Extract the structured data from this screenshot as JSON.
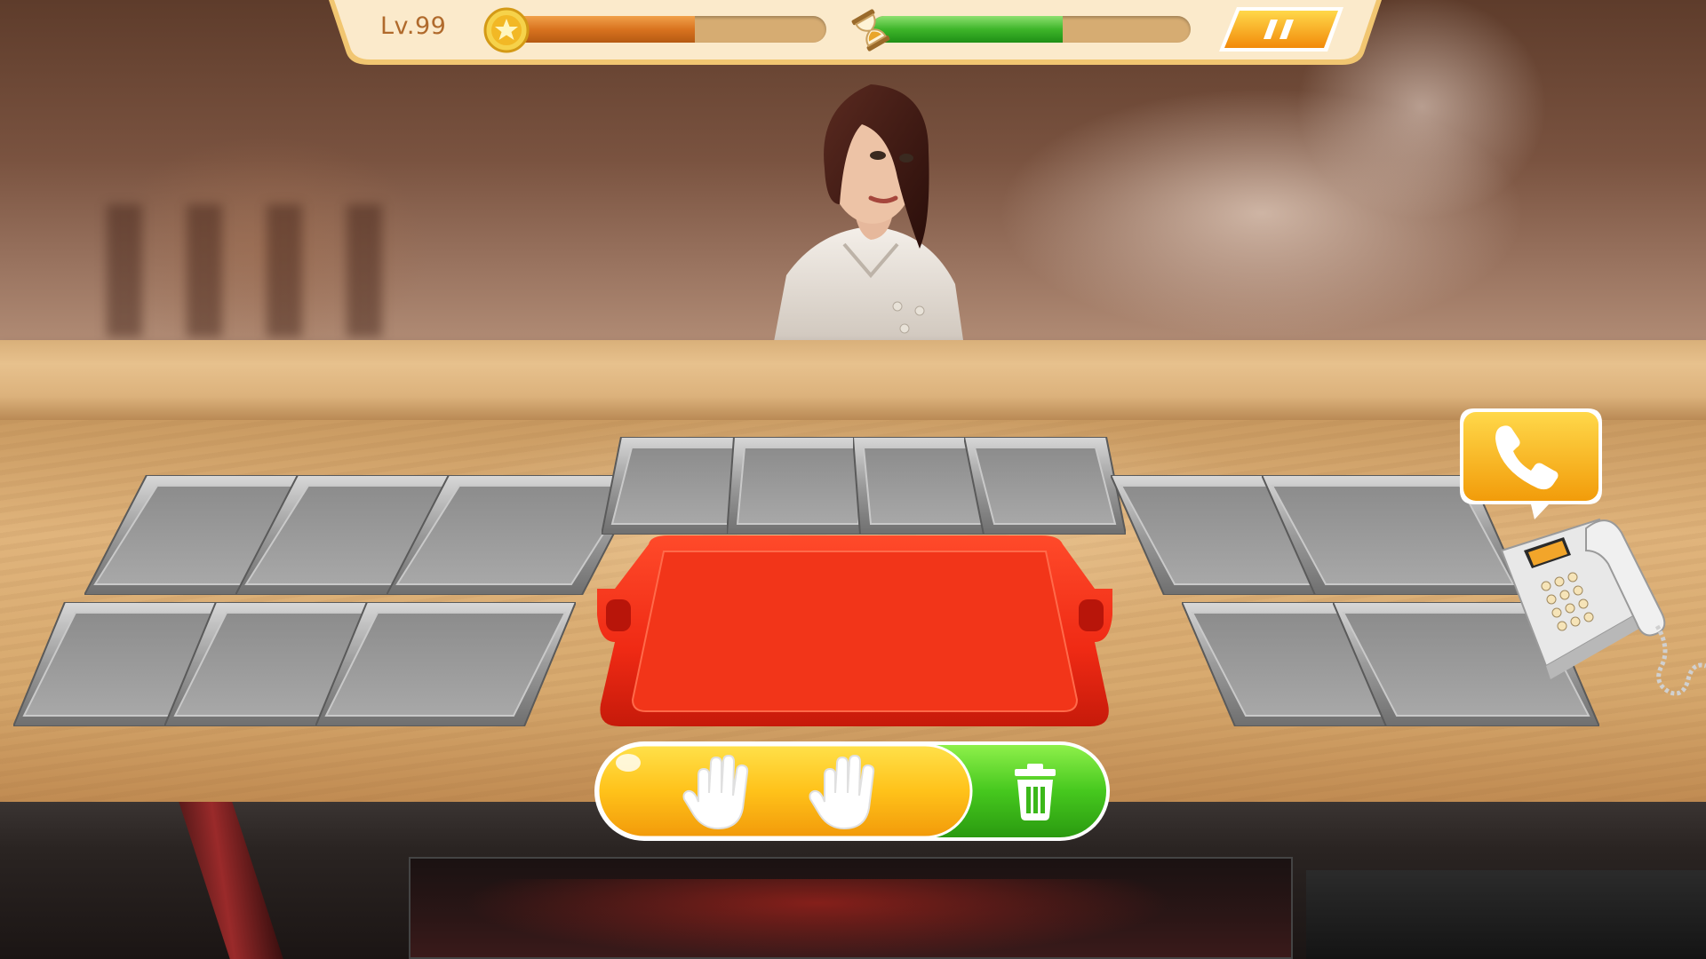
{
  "hud": {
    "level_label": "Lv.99",
    "coin_progress": 0.6,
    "time_progress": 0.6,
    "coin_icon": "star-coin-icon",
    "time_icon": "hourglass-icon",
    "pause_icon": "pause-icon"
  },
  "counter": {
    "left_trays": 6,
    "top_trays": 4,
    "right_trays": 4,
    "serving_tray_color": "#f03018"
  },
  "actions": {
    "left_hand_icon": "hand-icon",
    "right_hand_icon": "hand-icon",
    "trash_icon": "trash-icon"
  },
  "phone": {
    "bubble_icon": "phone-handset-icon"
  },
  "colors": {
    "accent_orange": "#f5a623",
    "accent_green": "#43c21e",
    "tray_red": "#f03018",
    "hud_bg": "#f7e2b6"
  }
}
